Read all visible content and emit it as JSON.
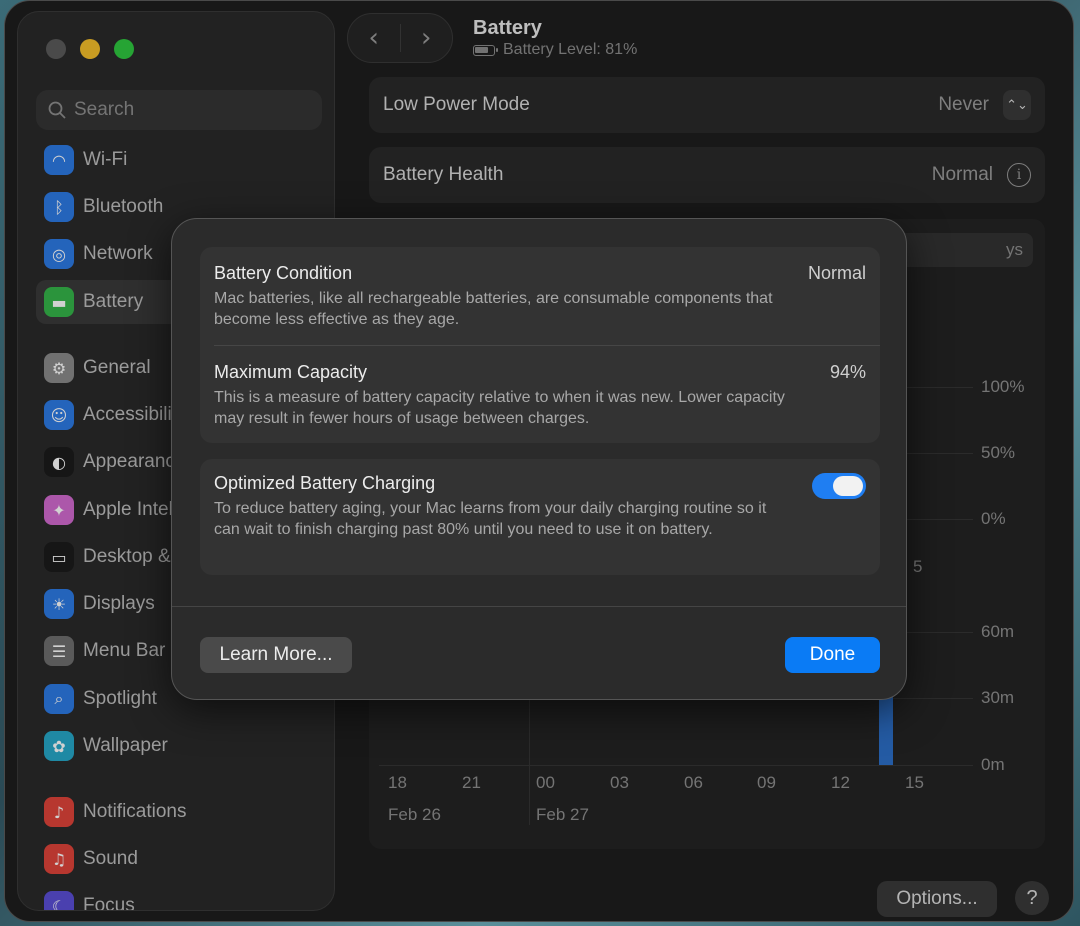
{
  "window": {
    "title": "Battery",
    "subtitle": "Battery Level: 81%"
  },
  "sidebar": {
    "search_placeholder": "Search",
    "items": [
      {
        "label": "Wi-Fi",
        "icon": "wifi-icon",
        "color": "#2d7ae5"
      },
      {
        "label": "Bluetooth",
        "icon": "bluetooth-icon",
        "color": "#2d7ae5"
      },
      {
        "label": "Network",
        "icon": "globe-icon",
        "color": "#2d7ae5"
      },
      {
        "label": "Battery",
        "icon": "battery-icon",
        "color": "#35b54a"
      },
      {
        "label": "General",
        "icon": "gear-icon",
        "color": "#8a8a8a"
      },
      {
        "label": "Accessibility",
        "icon": "accessibility-icon",
        "color": "#2d7ae5"
      },
      {
        "label": "Appearance",
        "icon": "appearance-icon",
        "color": "#1c1c1c"
      },
      {
        "label": "Apple Intelligence & Siri",
        "icon": "siri-icon",
        "color": "#d26bd0"
      },
      {
        "label": "Desktop & Dock",
        "icon": "dock-icon",
        "color": "#1c1c1c"
      },
      {
        "label": "Displays",
        "icon": "sun-icon",
        "color": "#2d7ae5"
      },
      {
        "label": "Menu Bar",
        "icon": "menubar-icon",
        "color": "#6e6e6e"
      },
      {
        "label": "Spotlight",
        "icon": "magnifier-icon",
        "color": "#2d7ae5"
      },
      {
        "label": "Wallpaper",
        "icon": "flower-icon",
        "color": "#27a8c8"
      },
      {
        "label": "Notifications",
        "icon": "bell-icon",
        "color": "#e0443a"
      },
      {
        "label": "Sound",
        "icon": "speaker-icon",
        "color": "#e0443a"
      },
      {
        "label": "Focus",
        "icon": "moon-icon",
        "color": "#5b4fd6"
      }
    ]
  },
  "settings": {
    "low_power_label": "Low Power Mode",
    "low_power_value": "Never",
    "health_label": "Battery Health",
    "health_value": "Normal",
    "segment_partial": "ys",
    "options_label": "Options...",
    "help_label": "?"
  },
  "chart": {
    "level_axis": [
      "100%",
      "50%",
      "0%"
    ],
    "usage_axis": [
      "60m",
      "30m",
      "0m"
    ],
    "x_ticks": [
      "18",
      "21",
      "00",
      "03",
      "06",
      "09",
      "12",
      "15"
    ],
    "dates": [
      "Feb 26",
      "Feb 27"
    ],
    "partial_tick": "5",
    "accent": "#2c6fc9"
  },
  "sheet": {
    "condition_title": "Battery Condition",
    "condition_value": "Normal",
    "condition_desc": "Mac batteries, like all rechargeable batteries, are consumable components that become less effective as they age.",
    "capacity_title": "Maximum Capacity",
    "capacity_value": "94%",
    "capacity_desc": "This is a measure of battery capacity relative to when it was new. Lower capacity may result in fewer hours of usage between charges.",
    "optimized_title": "Optimized Battery Charging",
    "optimized_desc": "To reduce battery aging, your Mac learns from your daily charging routine so it can wait to finish charging past 80% until you need to use it on battery.",
    "optimized_on": true,
    "learn_more": "Learn More...",
    "done": "Done",
    "accent": "#0a7bf5"
  }
}
